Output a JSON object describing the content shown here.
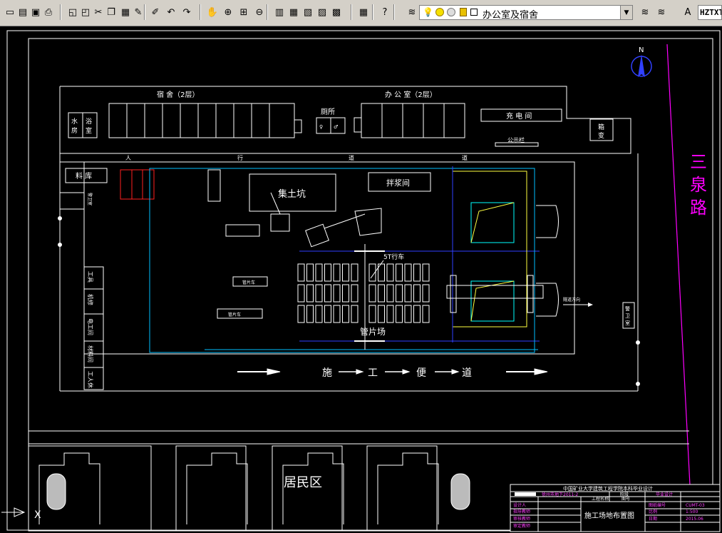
{
  "toolbar": {
    "buttons": [
      "new-icon",
      "open-icon",
      "save-icon",
      "print-icon",
      "preview-icon",
      "publish-icon",
      "cut-icon",
      "copy-icon",
      "paste-icon",
      "match-properties-icon",
      "block-editor-icon",
      "undo-icon",
      "redo-icon",
      "pan-icon",
      "zoom-realtime-icon",
      "zoom-window-icon",
      "zoom-previous-icon",
      "properties-icon",
      "design-center-icon",
      "tool-palettes-icon",
      "sheet-set-icon",
      "markup-icon",
      "calculator-icon",
      "help-icon"
    ],
    "layer_dropdown_value": "办公室及宿舍",
    "text_style_value": "HZTXT",
    "layer_state_icons": [
      "lightbulb-on-icon",
      "sun-icon",
      "freeze-icon",
      "lock-icon",
      "color-swatch-icon"
    ]
  },
  "drawing": {
    "road_name": [
      "三",
      "泉",
      "路"
    ],
    "north_label": "N",
    "dormitory_label": "宿 舍（2层）",
    "office_label": "办 公 室（2层）",
    "toilet_label": "厕所",
    "toilet_sub": [
      "♀",
      "♂"
    ],
    "water_room_label": [
      "水",
      "房"
    ],
    "bath_label": [
      "浴",
      "室"
    ],
    "charging_room_label": "充 电 间",
    "bulletin_label": "公示栏",
    "box_transformer_label": [
      "箱",
      "变"
    ],
    "sidewalk_label": [
      "人",
      "行",
      "道",
      "道"
    ],
    "material_storage_label": "料 库",
    "guard_room_left": "警卫室",
    "sump_label": "集土坑",
    "grout_room_label": "拌浆间",
    "crane_label": "5T行车",
    "segment_yard_label": "管片场",
    "segment_truck_label": "管片车",
    "tunnel_direction_label": "隧道方向",
    "guard_room_right": [
      "警",
      "卫",
      "室"
    ],
    "side_rooms": [
      "工具",
      "机修",
      "电工间",
      "材料间",
      "工人休"
    ],
    "construction_road": [
      "施",
      "工",
      "便",
      "道"
    ],
    "residential_label": "居民区",
    "axis_label": "X",
    "title_block": {
      "university": "中国矿业大学建筑工程学院本科毕业设计",
      "project": "徐州市地下2011-2",
      "drawing_title": "施工场地布置图",
      "rows_left": [
        "设计人",
        "指导教师",
        "审核教师",
        "审定教师"
      ],
      "rows_right_keys": [
        "图纸编号",
        "比例",
        "日期"
      ],
      "rows_right_vals": [
        "CUMT-03",
        "1:500",
        "2015.06"
      ],
      "header_cells": [
        "工程名称",
        "图号",
        "阶段",
        "毕业设计"
      ]
    }
  }
}
